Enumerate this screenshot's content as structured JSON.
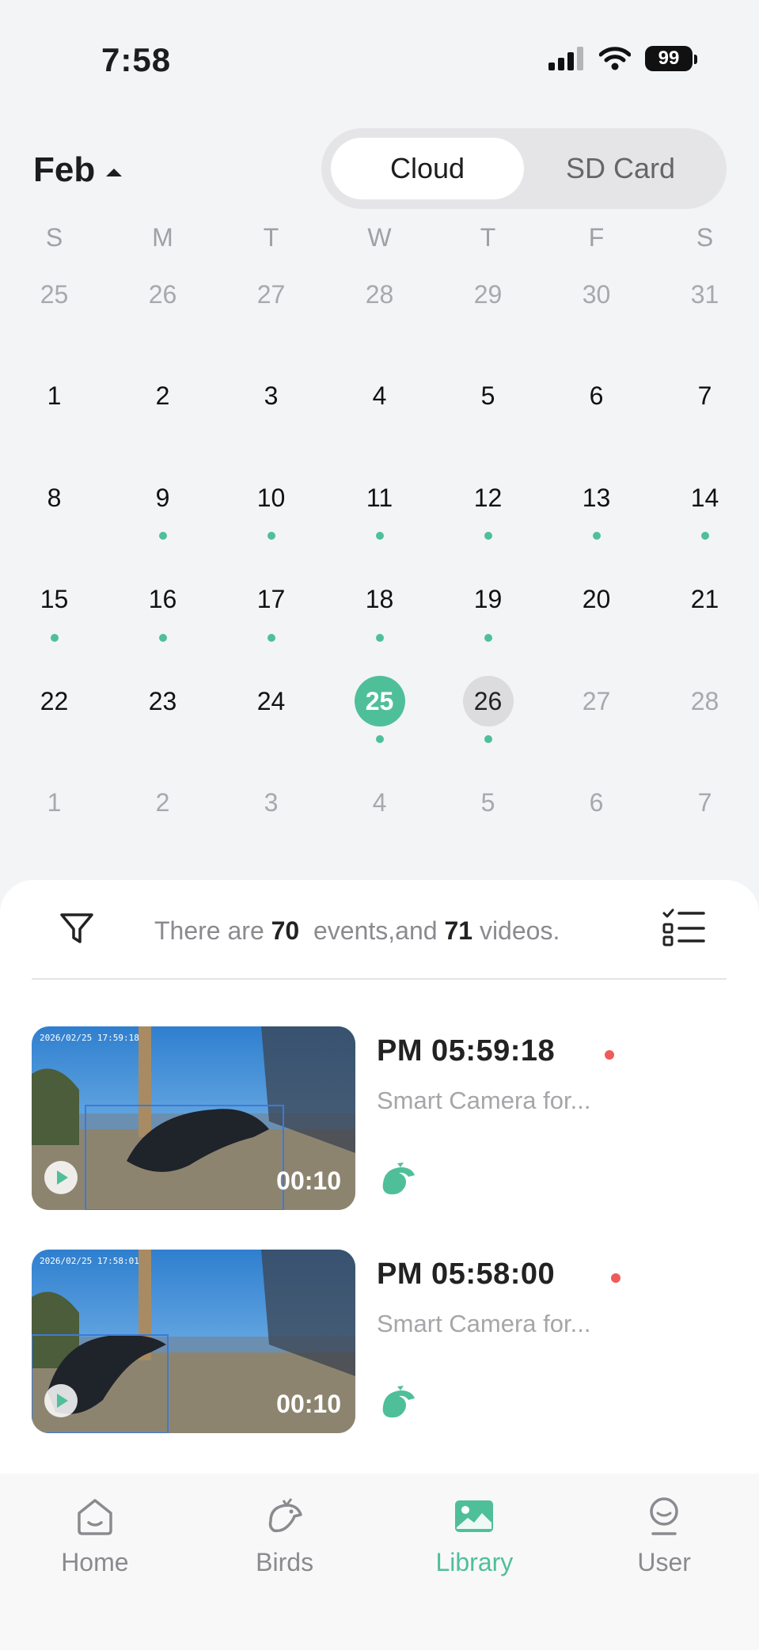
{
  "status_bar": {
    "time": "7:58",
    "battery": "99"
  },
  "calendar": {
    "month": "Feb",
    "source_options": [
      "Cloud",
      "SD Card"
    ],
    "active_source": "Cloud",
    "weekdays": [
      "S",
      "M",
      "T",
      "W",
      "T",
      "F",
      "S"
    ],
    "weeks": [
      [
        {
          "d": "25",
          "m": 1
        },
        {
          "d": "26",
          "m": 1
        },
        {
          "d": "27",
          "m": 1
        },
        {
          "d": "28",
          "m": 1
        },
        {
          "d": "29",
          "m": 1
        },
        {
          "d": "30",
          "m": 1
        },
        {
          "d": "31",
          "m": 1
        }
      ],
      [
        {
          "d": "1"
        },
        {
          "d": "2"
        },
        {
          "d": "3"
        },
        {
          "d": "4"
        },
        {
          "d": "5"
        },
        {
          "d": "6"
        },
        {
          "d": "7"
        }
      ],
      [
        {
          "d": "8"
        },
        {
          "d": "9",
          "e": 1
        },
        {
          "d": "10",
          "e": 1
        },
        {
          "d": "11",
          "e": 1
        },
        {
          "d": "12",
          "e": 1
        },
        {
          "d": "13",
          "e": 1
        },
        {
          "d": "14",
          "e": 1
        }
      ],
      [
        {
          "d": "15",
          "e": 1
        },
        {
          "d": "16",
          "e": 1
        },
        {
          "d": "17",
          "e": 1
        },
        {
          "d": "18",
          "e": 1
        },
        {
          "d": "19",
          "e": 1
        },
        {
          "d": "20"
        },
        {
          "d": "21"
        }
      ],
      [
        {
          "d": "22"
        },
        {
          "d": "23"
        },
        {
          "d": "24"
        },
        {
          "d": "25",
          "e": 1,
          "sel": 1
        },
        {
          "d": "26",
          "e": 1,
          "today": 1
        },
        {
          "d": "27",
          "m": 1
        },
        {
          "d": "28",
          "m": 1
        }
      ],
      [
        {
          "d": "1",
          "m": 1
        },
        {
          "d": "2",
          "m": 1
        },
        {
          "d": "3",
          "m": 1
        },
        {
          "d": "4",
          "m": 1
        },
        {
          "d": "5",
          "m": 1
        },
        {
          "d": "6",
          "m": 1
        },
        {
          "d": "7",
          "m": 1
        }
      ]
    ],
    "selected_color": "#4fbf9a",
    "today_color": "#dcdcdf"
  },
  "summary": {
    "prefix": "There are ",
    "events": "70",
    "middle": "  events,and ",
    "videos": "71",
    "suffix": " videos."
  },
  "events": [
    {
      "time": "PM 05:59:18",
      "device": "Smart Camera for...",
      "duration": "00:10",
      "stamp": "2026/02/25 17:59:18",
      "new": true
    },
    {
      "time": "PM 05:58:00",
      "device": "Smart Camera for...",
      "duration": "00:10",
      "stamp": "2026/02/25 17:58:01",
      "new": true
    }
  ],
  "tabs": [
    {
      "label": "Home",
      "icon": "home-icon"
    },
    {
      "label": "Birds",
      "icon": "bird-icon"
    },
    {
      "label": "Library",
      "icon": "library-icon",
      "active": true
    },
    {
      "label": "User",
      "icon": "user-icon"
    }
  ],
  "colors": {
    "accent": "#4fbf9a",
    "new_indicator": "#ef5b5b"
  }
}
